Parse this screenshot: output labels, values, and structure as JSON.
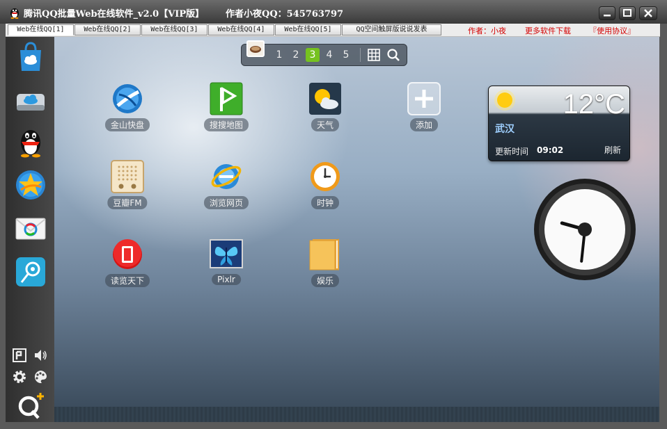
{
  "titlebar": {
    "title": "腾讯QQ批量Web在线软件_v2.0【VIP版】",
    "author": "作者小夜QQ：545763797"
  },
  "tabs": [
    {
      "label": "Web在线QQ[1]",
      "active": true
    },
    {
      "label": "Web在线QQ[2]",
      "active": false
    },
    {
      "label": "Web在线QQ[3]",
      "active": false
    },
    {
      "label": "Web在线QQ[4]",
      "active": false
    },
    {
      "label": "Web在线QQ[5]",
      "active": false
    },
    {
      "label": "QQ空间触屏版说说发表",
      "active": false
    }
  ],
  "links": {
    "author": "作者：小夜",
    "more_software": "更多软件下载",
    "agreement": "『使用协议』"
  },
  "sidebar": {
    "icons": [
      "app-market-icon",
      "cloud-drive-icon",
      "qq-penguin-icon",
      "qzone-star-icon",
      "qq-mail-icon",
      "qq-music-icon"
    ],
    "tools": [
      "pinboard-icon",
      "volume-icon",
      "settings-gear-icon",
      "theme-palette-icon"
    ],
    "logo": "q-plus-logo"
  },
  "pager": {
    "pages": [
      "1",
      "2",
      "3",
      "4",
      "5"
    ],
    "active_page": "3"
  },
  "apps": [
    {
      "label": "金山快盘",
      "icon": "kuaipan-icon"
    },
    {
      "label": "搜搜地图",
      "icon": "soso-map-icon"
    },
    {
      "label": "天气",
      "icon": "weather-icon"
    },
    {
      "label": "添加",
      "icon": "add-icon"
    },
    {
      "label": "豆瓣FM",
      "icon": "douban-fm-icon"
    },
    {
      "label": "浏览网页",
      "icon": "browser-icon"
    },
    {
      "label": "时钟",
      "icon": "clock-icon"
    },
    {
      "label": "读览天下",
      "icon": "dulan-icon"
    },
    {
      "label": "Pixlr",
      "icon": "pixlr-icon"
    },
    {
      "label": "娱乐",
      "icon": "entertainment-folder-icon"
    }
  ],
  "weather": {
    "temp": "12°C",
    "city": "武汉",
    "update_label": "更新时间",
    "update_time": "09:02",
    "refresh": "刷新"
  },
  "clock": {
    "hour": 9,
    "minute": 31
  },
  "colors": {
    "link_red": "#d40000",
    "page_active": "#76c21f",
    "city_blue": "#9fd0ff"
  }
}
